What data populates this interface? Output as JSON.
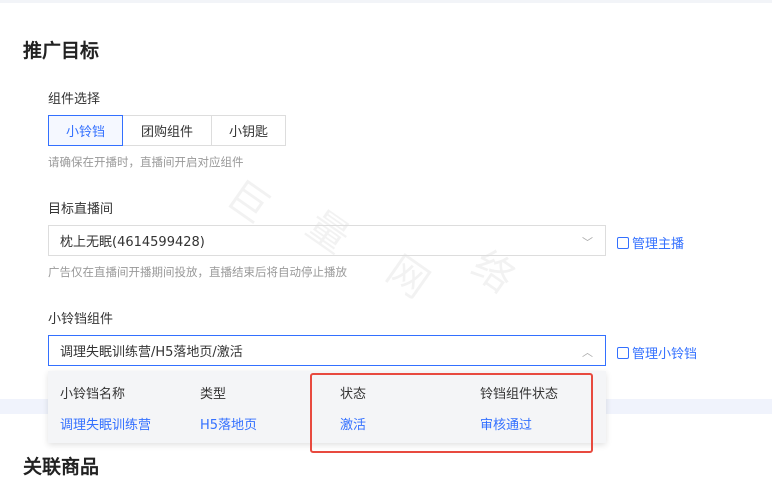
{
  "section1_title": "推广目标",
  "component": {
    "label": "组件选择",
    "options": [
      "小铃铛",
      "团购组件",
      "小钥匙"
    ],
    "selected": "小铃铛",
    "hint": "请确保在开播时，直播间开启对应组件"
  },
  "room": {
    "label": "目标直播间",
    "value": "枕上无眠(4614599428)",
    "link": "管理主播",
    "hint": "广告仅在直播间开播期间投放，直播结束后将自动停止播放"
  },
  "bell": {
    "label": "小铃铛组件",
    "value": "调理失眠训练营/H5落地页/激活",
    "link": "管理小铃铛",
    "dropdown": {
      "headers": [
        "小铃铛名称",
        "类型",
        "状态",
        "铃铛组件状态"
      ],
      "row": [
        "调理失眠训练营",
        "H5落地页",
        "激活",
        "审核通过"
      ]
    }
  },
  "section2_title": "关联商品",
  "watermark": [
    "巨",
    "量",
    "网",
    "络"
  ],
  "colors": {
    "accent": "#3370ff",
    "highlight": "#e84a3f"
  }
}
